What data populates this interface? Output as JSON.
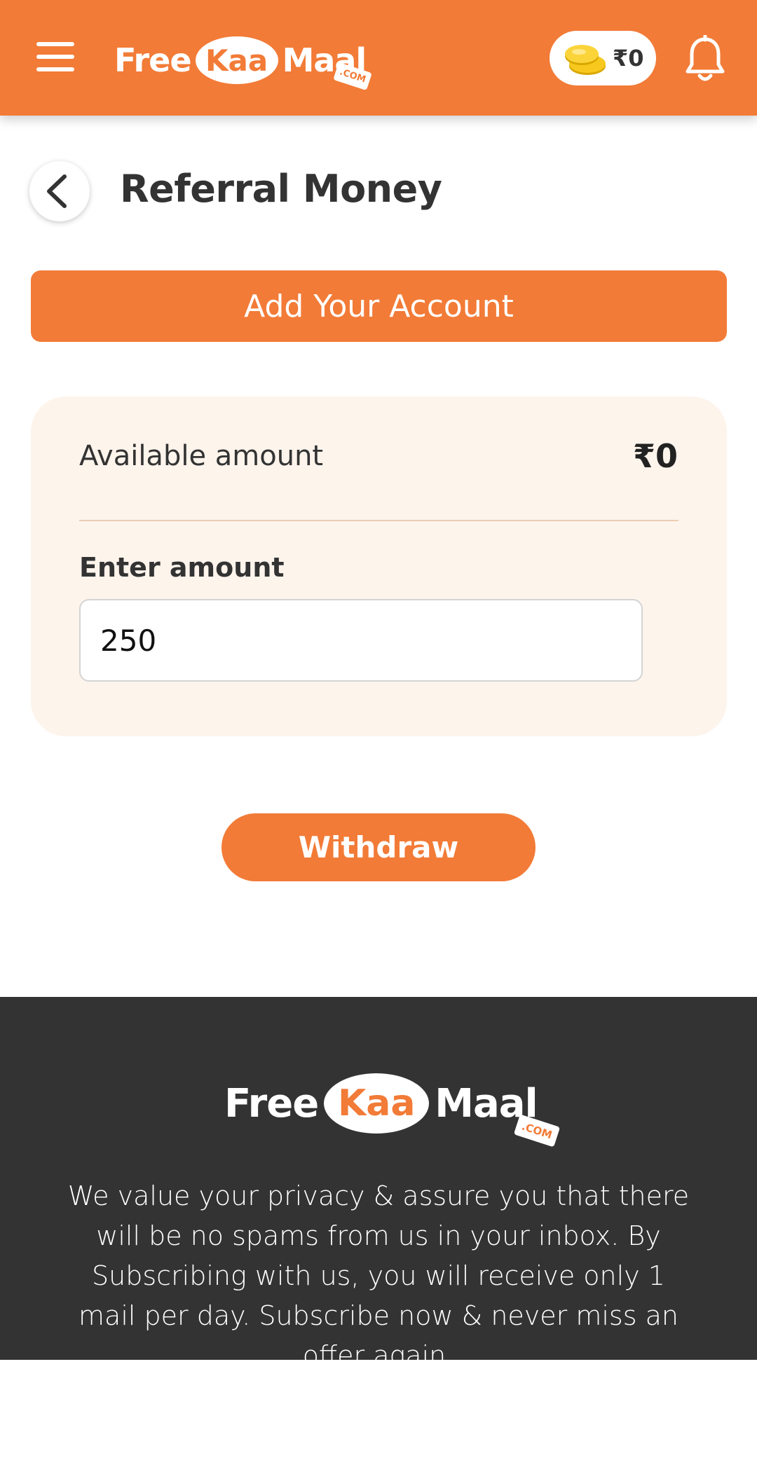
{
  "header": {
    "logo": {
      "free": "Free",
      "kaa": "Kaa",
      "maal": "Maal",
      "dotcom": ".COM"
    },
    "wallet_amount": "₹0",
    "icons": {
      "menu": "hamburger-menu-icon",
      "coins": "coins-icon",
      "bell": "bell-icon"
    }
  },
  "page": {
    "title": "Referral Money",
    "back_icon": "chevron-left-icon"
  },
  "add_account_label": "Add Your Account",
  "card": {
    "available_label": "Available amount",
    "available_value": "₹0",
    "enter_label": "Enter amount",
    "amount_value": "250"
  },
  "withdraw_label": "Withdraw",
  "footer": {
    "logo": {
      "free": "Free",
      "kaa": "Kaa",
      "maal": "Maal",
      "dotcom": ".COM"
    },
    "text": "We value your privacy & assure you that there will be no spams from us in your inbox. By Subscribing with us, you will receive only 1 mail per day. Subscribe now & never miss an offer again."
  },
  "colors": {
    "brand_orange": "#f27b37",
    "card_bg": "#fdf4ec",
    "footer_bg": "#333333"
  }
}
